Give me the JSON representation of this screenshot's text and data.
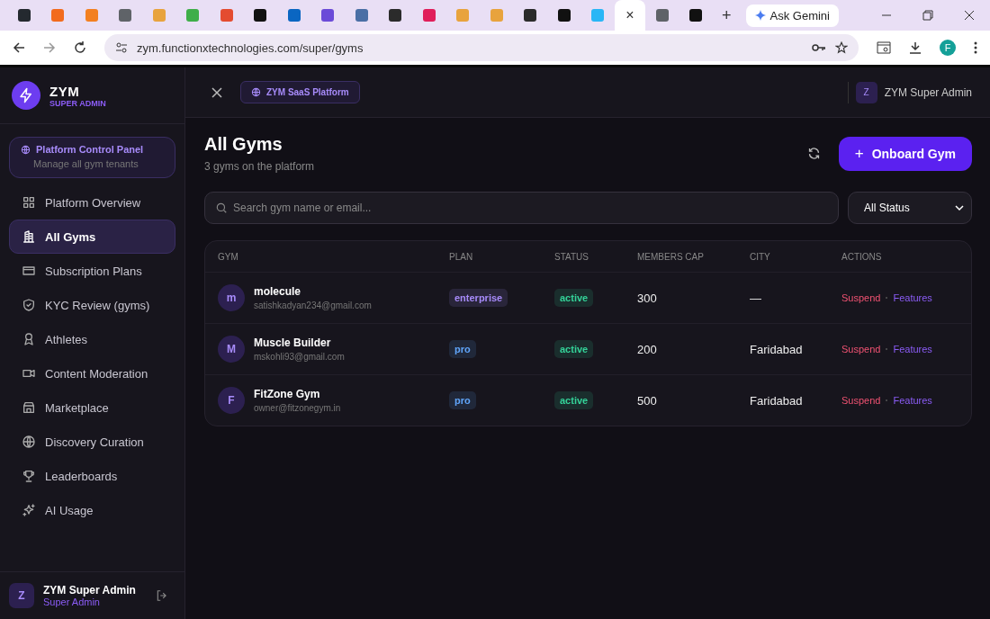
{
  "browser": {
    "tabs": [
      {
        "color": "#24292f",
        "selected": false
      },
      {
        "color": "#f26b1d",
        "selected": false
      },
      {
        "color": "#f38020",
        "selected": false
      },
      {
        "color": "#5f6368",
        "selected": false
      },
      {
        "color": "#e8a33d",
        "selected": false
      },
      {
        "color": "#3fae49",
        "selected": false
      },
      {
        "color": "#e44c30",
        "selected": false
      },
      {
        "color": "#111111",
        "selected": false
      },
      {
        "color": "#0a66c2",
        "selected": false
      },
      {
        "color": "#6b4bd8",
        "selected": false
      },
      {
        "color": "#4a6fa5",
        "selected": false
      },
      {
        "color": "#2b2b2b",
        "selected": false
      },
      {
        "color": "#e01e5a",
        "selected": false
      },
      {
        "color": "#e8a33d",
        "selected": false
      },
      {
        "color": "#e8a33d",
        "selected": false
      },
      {
        "color": "#2b2b2b",
        "selected": false
      },
      {
        "color": "#111111",
        "selected": false
      },
      {
        "color": "#29b6f6",
        "selected": false
      },
      {
        "selected": true,
        "close": "×"
      },
      {
        "color": "#5f6368",
        "selected": false
      },
      {
        "color": "#111111",
        "selected": false
      }
    ],
    "new_tab": "+",
    "gemini": "Ask Gemini",
    "url": "zym.functionxtechnologies.com/super/gyms",
    "profile": "F"
  },
  "sidebar": {
    "brand": "ZYM",
    "role": "SUPER ADMIN",
    "panel": {
      "title": "Platform Control Panel",
      "subtitle": "Manage all gym tenants"
    },
    "items": [
      {
        "label": "Platform Overview",
        "selected": false
      },
      {
        "label": "All Gyms",
        "selected": true
      },
      {
        "label": "Subscription Plans",
        "selected": false
      },
      {
        "label": "KYC Review (gyms)",
        "selected": false
      },
      {
        "label": "Athletes",
        "selected": false
      },
      {
        "label": "Content Moderation",
        "selected": false
      },
      {
        "label": "Marketplace",
        "selected": false
      },
      {
        "label": "Discovery Curation",
        "selected": false
      },
      {
        "label": "Leaderboards",
        "selected": false
      },
      {
        "label": "AI Usage",
        "selected": false
      }
    ],
    "user": {
      "initial": "Z",
      "name": "ZYM Super Admin",
      "role": "Super Admin"
    }
  },
  "header": {
    "badge": "ZYM SaaS Platform",
    "user_initial": "Z",
    "user_name": "ZYM Super Admin"
  },
  "page": {
    "title": "All Gyms",
    "subtitle": "3 gyms on the platform",
    "primary_button": "Onboard Gym",
    "primary_icon": "+",
    "search": {
      "placeholder": "Search gym name or email..."
    },
    "filter": "All Status"
  },
  "table": {
    "columns": [
      "GYM",
      "PLAN",
      "STATUS",
      "MEMBERS CAP",
      "CITY",
      "ACTIONS"
    ],
    "rows": [
      {
        "initial": "m",
        "name": "molecule",
        "email": "satishkadyan234@gmail.com",
        "plan": {
          "label": "enterprise",
          "color": "#a78bfa"
        },
        "status": {
          "label": "active",
          "color": "#34d399"
        },
        "members_cap": "300",
        "city": "—",
        "actions": [
          "Suspend",
          "Features"
        ]
      },
      {
        "initial": "M",
        "name": "Muscle Builder",
        "email": "mskohli93@gmail.com",
        "plan": {
          "label": "pro",
          "color": "#60a5fa"
        },
        "status": {
          "label": "active",
          "color": "#34d399"
        },
        "members_cap": "200",
        "city": "Faridabad",
        "actions": [
          "Suspend",
          "Features"
        ]
      },
      {
        "initial": "F",
        "name": "FitZone Gym",
        "email": "owner@fitzonegym.in",
        "plan": {
          "label": "pro",
          "color": "#60a5fa"
        },
        "status": {
          "label": "active",
          "color": "#34d399"
        },
        "members_cap": "500",
        "city": "Faridabad",
        "actions": [
          "Suspend",
          "Features"
        ]
      }
    ]
  }
}
